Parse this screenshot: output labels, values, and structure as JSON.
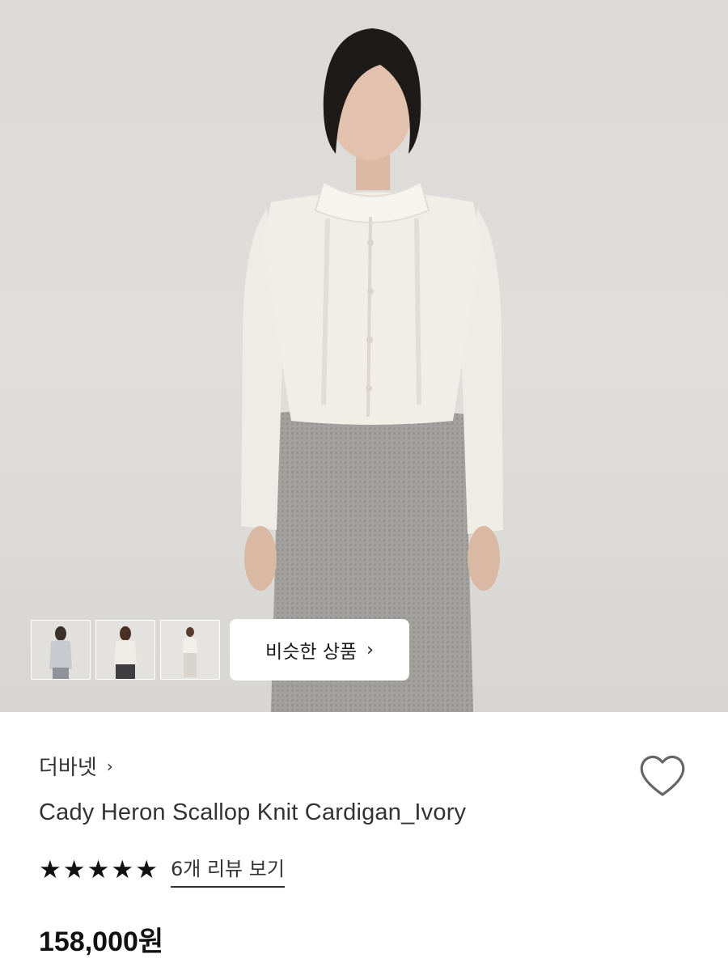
{
  "gallery": {
    "thumbnails": [
      {
        "name": "thumb-1"
      },
      {
        "name": "thumb-2"
      },
      {
        "name": "thumb-3"
      }
    ],
    "similar_button_label": "비슷한 상품",
    "similar_button_icon": "chevron-right-icon"
  },
  "product": {
    "brand": "더바넷",
    "brand_icon": "chevron-right-icon",
    "name": "Cady Heron Scallop Knit Cardigan_Ivory",
    "rating_stars": 5,
    "review_link": "6개 리뷰 보기",
    "price": "158,000원",
    "wishlist_icon": "heart-outline-icon"
  },
  "colors": {
    "background": "#ffffff",
    "text_primary": "#111111",
    "hero_bg": "#dcdad6"
  }
}
